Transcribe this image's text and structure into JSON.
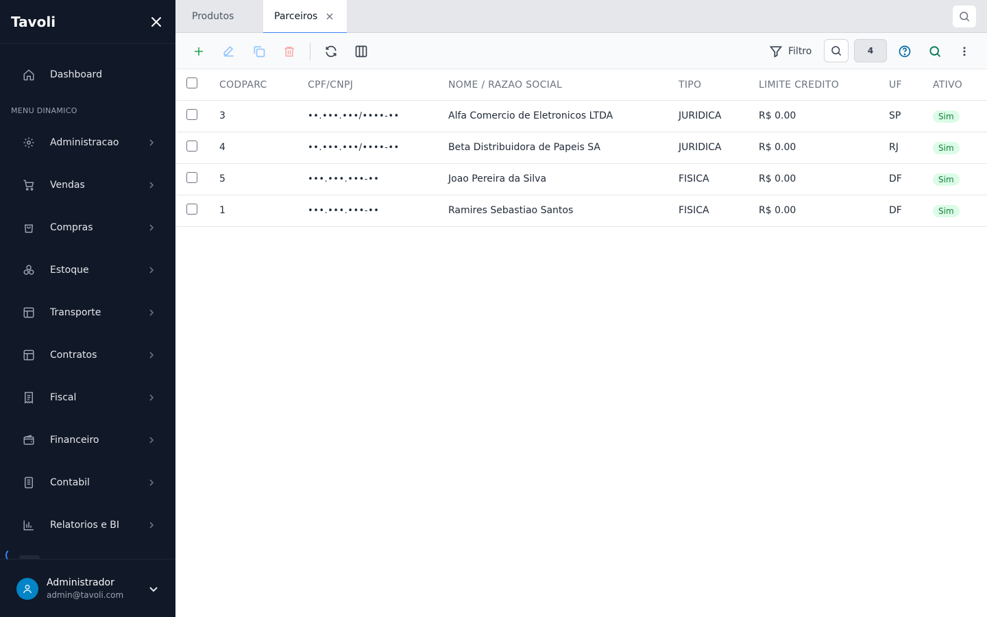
{
  "sidebar": {
    "brand": "Tavoli",
    "dashboard_label": "Dashboard",
    "section_label": "MENU DINAMICO",
    "items": [
      {
        "label": "Administracao",
        "icon": "gear-icon"
      },
      {
        "label": "Vendas",
        "icon": "cart-icon"
      },
      {
        "label": "Compras",
        "icon": "shopping-bag-icon"
      },
      {
        "label": "Estoque",
        "icon": "boxes-icon"
      },
      {
        "label": "Transporte",
        "icon": "layout-icon"
      },
      {
        "label": "Contratos",
        "icon": "layout-icon"
      },
      {
        "label": "Fiscal",
        "icon": "receipt-icon"
      },
      {
        "label": "Financeiro",
        "icon": "wallet-icon"
      },
      {
        "label": "Contabil",
        "icon": "document-icon"
      },
      {
        "label": "Relatorios e BI",
        "icon": "bar-chart-icon"
      }
    ],
    "user": {
      "name": "Administrador",
      "email": "admin@tavoli.com"
    }
  },
  "tabs": [
    {
      "label": "Produtos",
      "active": false
    },
    {
      "label": "Parceiros",
      "active": true
    }
  ],
  "toolbar": {
    "filter_label": "Filtro",
    "count": "4"
  },
  "table": {
    "columns": [
      "CODPARC",
      "CPF/CNPJ",
      "NOME / RAZAO SOCIAL",
      "TIPO",
      "LIMITE CREDITO",
      "UF",
      "ATIVO"
    ],
    "rows": [
      {
        "codparc": "3",
        "doc": "••.•••.•••/••••-••",
        "nome": "Alfa Comercio de Eletronicos LTDA",
        "tipo": "JURIDICA",
        "limite": "R$ 0.00",
        "uf": "SP",
        "ativo": "Sim"
      },
      {
        "codparc": "4",
        "doc": "••.•••.•••/••••-••",
        "nome": "Beta Distribuidora de Papeis SA",
        "tipo": "JURIDICA",
        "limite": "R$ 0.00",
        "uf": "RJ",
        "ativo": "Sim"
      },
      {
        "codparc": "5",
        "doc": "•••.•••.•••-••",
        "nome": "Joao Pereira da Silva",
        "tipo": "FISICA",
        "limite": "R$ 0.00",
        "uf": "DF",
        "ativo": "Sim"
      },
      {
        "codparc": "1",
        "doc": "•••.•••.•••-••",
        "nome": "Ramires Sebastiao Santos",
        "tipo": "FISICA",
        "limite": "R$ 0.00",
        "uf": "DF",
        "ativo": "Sim"
      }
    ]
  },
  "colors": {
    "sidebar_bg": "#111827",
    "accent": "#3b82f6",
    "add": "#16a34a",
    "delete": "#ef4444",
    "badge_bg": "#dcfce7",
    "badge_text": "#15803d"
  }
}
